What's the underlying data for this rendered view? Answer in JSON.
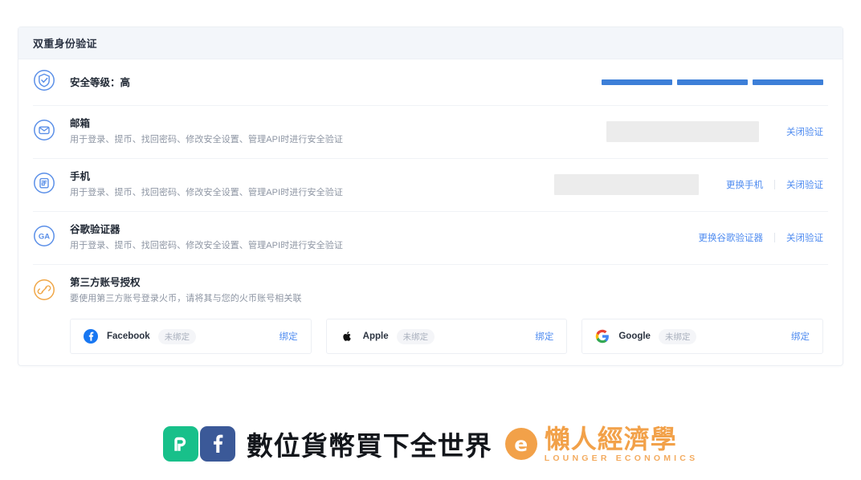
{
  "card": {
    "header_title": "双重身份验证"
  },
  "security_level": {
    "label": "安全等级：",
    "value": "高",
    "icon": "shield-check-icon",
    "bars": 3,
    "bar_color": "#3d7fd8"
  },
  "shared": {
    "description": "用于登录、提币、找回密码、修改安全设置、管理API时进行安全验证",
    "close_verification_label": "关闭验证"
  },
  "rows": [
    {
      "key": "email",
      "icon": "envelope-icon",
      "title": "邮箱",
      "desc": "用于登录、提币、找回密码、修改安全设置、管理API时进行安全验证",
      "masked_value": "",
      "links": [
        "关闭验证"
      ]
    },
    {
      "key": "phone",
      "icon": "mobile-phone-icon",
      "title": "手机",
      "desc": "用于登录、提币、找回密码、修改安全设置、管理API时进行安全验证",
      "masked_value": "",
      "links": [
        "更换手机",
        "关闭验证"
      ]
    },
    {
      "key": "google_authenticator",
      "icon": "ga-circle-icon",
      "title": "谷歌验证器",
      "desc": "用于登录、提币、找回密码、修改安全设置、管理API时进行安全验证",
      "masked_value": null,
      "links": [
        "更换谷歌验证器",
        "关闭验证"
      ]
    }
  ],
  "third_party": {
    "icon": "link-chain-icon",
    "title": "第三方账号授权",
    "desc": "要使用第三方账号登录火币，请将其与您的火币账号相关联",
    "bind_label": "绑定",
    "unbound_label": "未绑定",
    "providers": [
      {
        "name": "Facebook",
        "icon": "facebook-icon",
        "status": "未绑定",
        "action": "绑定"
      },
      {
        "name": "Apple",
        "icon": "apple-icon",
        "status": "未绑定",
        "action": "绑定"
      },
      {
        "name": "Google",
        "icon": "google-icon",
        "status": "未绑定",
        "action": "绑定"
      }
    ]
  },
  "watermark": {
    "headline": "數位貨幣買下全世界",
    "brand_cn": "懶人經濟學",
    "brand_en": "LOUNGER ECONOMICS",
    "brand_color": "#f2a149",
    "line_icon": "line-app-icon",
    "facebook_icon": "facebook-icon"
  }
}
